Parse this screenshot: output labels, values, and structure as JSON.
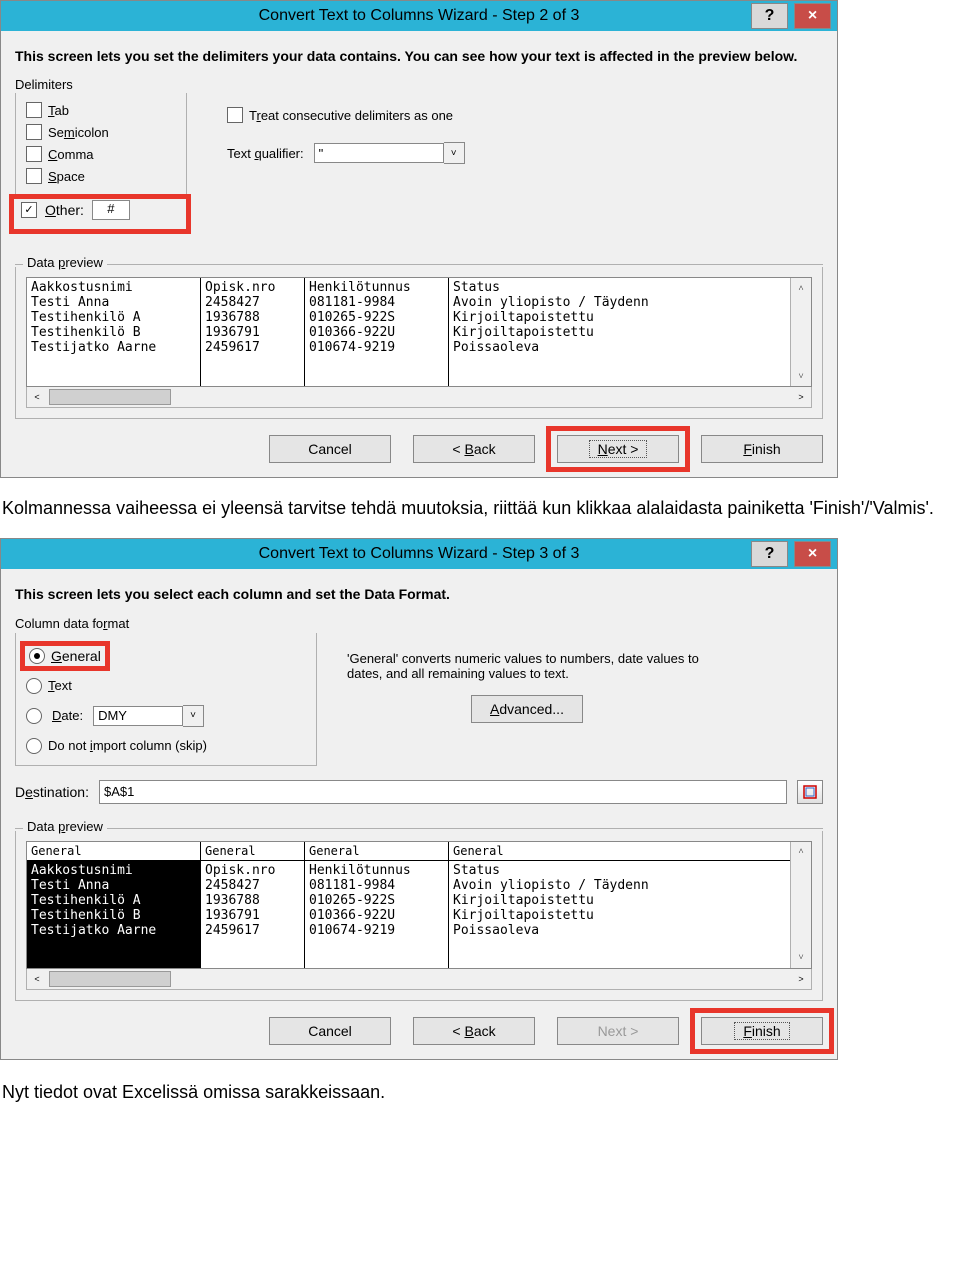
{
  "dialog1": {
    "title": "Convert Text to Columns Wizard - Step 2 of 3",
    "help": "?",
    "close": "×",
    "instruction": "This screen lets you set the delimiters your data contains.  You can see how your text is affected in the preview below.",
    "delimiters_label": "Delimiters",
    "tab": "Tab",
    "semicolon": "Semicolon",
    "comma": "Comma",
    "space": "Space",
    "other": "Other:",
    "other_value": "#",
    "treat": "Treat consecutive delimiters as one",
    "qualifier_label": "Text qualifier:",
    "qualifier_value": "\"",
    "preview_label": "Data preview",
    "buttons": {
      "cancel": "Cancel",
      "back": "< Back",
      "next": "Next >",
      "finish": "Finish"
    }
  },
  "dialog2": {
    "title": "Convert Text to Columns Wizard - Step 3 of 3",
    "instruction": "This screen lets you select each column and set the Data Format.",
    "cdf_label": "Column data format",
    "general": "General",
    "text": "Text",
    "date": "Date:",
    "date_value": "DMY",
    "skip": "Do not import column (skip)",
    "hint": "'General' converts numeric values to numbers, date values to dates, and all remaining values to text.",
    "advanced": "Advanced...",
    "destination_label": "Destination:",
    "destination_value": "$A$1",
    "preview_label": "Data preview",
    "col_header": "General",
    "buttons": {
      "cancel": "Cancel",
      "back": "< Back",
      "next": "Next >",
      "finish": "Finish"
    }
  },
  "preview_data": {
    "col1": [
      "Aakkostusnimi",
      "Testi Anna",
      "Testihenkilö A",
      "Testihenkilö B",
      "Testijatko Aarne"
    ],
    "col2": [
      "Opisk.nro",
      "2458427",
      "1936788",
      "1936791",
      "2459617"
    ],
    "col3": [
      "Henkilötunnus",
      "081181-9984",
      "010265-922S",
      "010366-922U",
      "010674-9219"
    ],
    "col4": [
      "Status",
      "Avoin yliopisto / Täydenn",
      "Kirjoiltapoistettu",
      "Kirjoiltapoistettu",
      "Poissaoleva"
    ]
  },
  "body_text1": "Kolmannessa vaiheessa ei yleensä tarvitse tehdä muutoksia, riittää kun klikkaa alalaidasta painiketta 'Finish'/'Valmis'.",
  "body_text2": "Nyt tiedot ovat Excelissä omissa sarakkeissaan."
}
